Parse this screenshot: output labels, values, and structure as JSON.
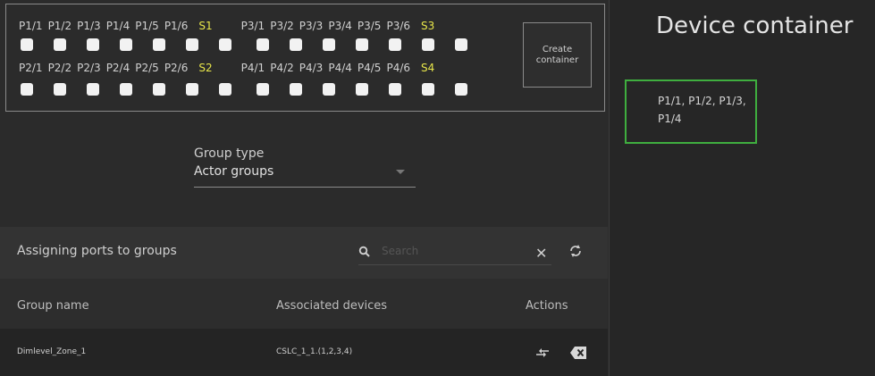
{
  "ports": {
    "row1_labels": [
      "P1/1",
      "P1/2",
      "P1/3",
      "P1/4",
      "P1/5",
      "P1/6"
    ],
    "row1_s": "S1",
    "row1b_labels": [
      "P3/1",
      "P3/2",
      "P3/3",
      "P3/4",
      "P3/5",
      "P3/6"
    ],
    "row1b_s": "S3",
    "row2_labels": [
      "P2/1",
      "P2/2",
      "P2/3",
      "P2/4",
      "P2/5",
      "P2/6"
    ],
    "row2_s": "S2",
    "row2b_labels": [
      "P4/1",
      "P4/2",
      "P4/3",
      "P4/4",
      "P4/5",
      "P4/6"
    ],
    "row2b_s": "S4"
  },
  "create_button": "Create container",
  "group_type": {
    "label": "Group type",
    "value": "Actor groups"
  },
  "assign": {
    "title": "Assigning ports to groups",
    "search_placeholder": "Search"
  },
  "table": {
    "headers": {
      "name": "Group name",
      "devices": "Associated devices",
      "actions": "Actions"
    },
    "rows": [
      {
        "name": "Dimlevel_Zone_1",
        "devices": "CSLC_1_1.(1,2,3,4)"
      }
    ]
  },
  "device_container": {
    "title": "Device container",
    "content": "P1/1, P1/2, P1/3, P1/4"
  },
  "colors": {
    "accent_yellow": "#e8e64a",
    "container_border": "#3fae3f"
  }
}
